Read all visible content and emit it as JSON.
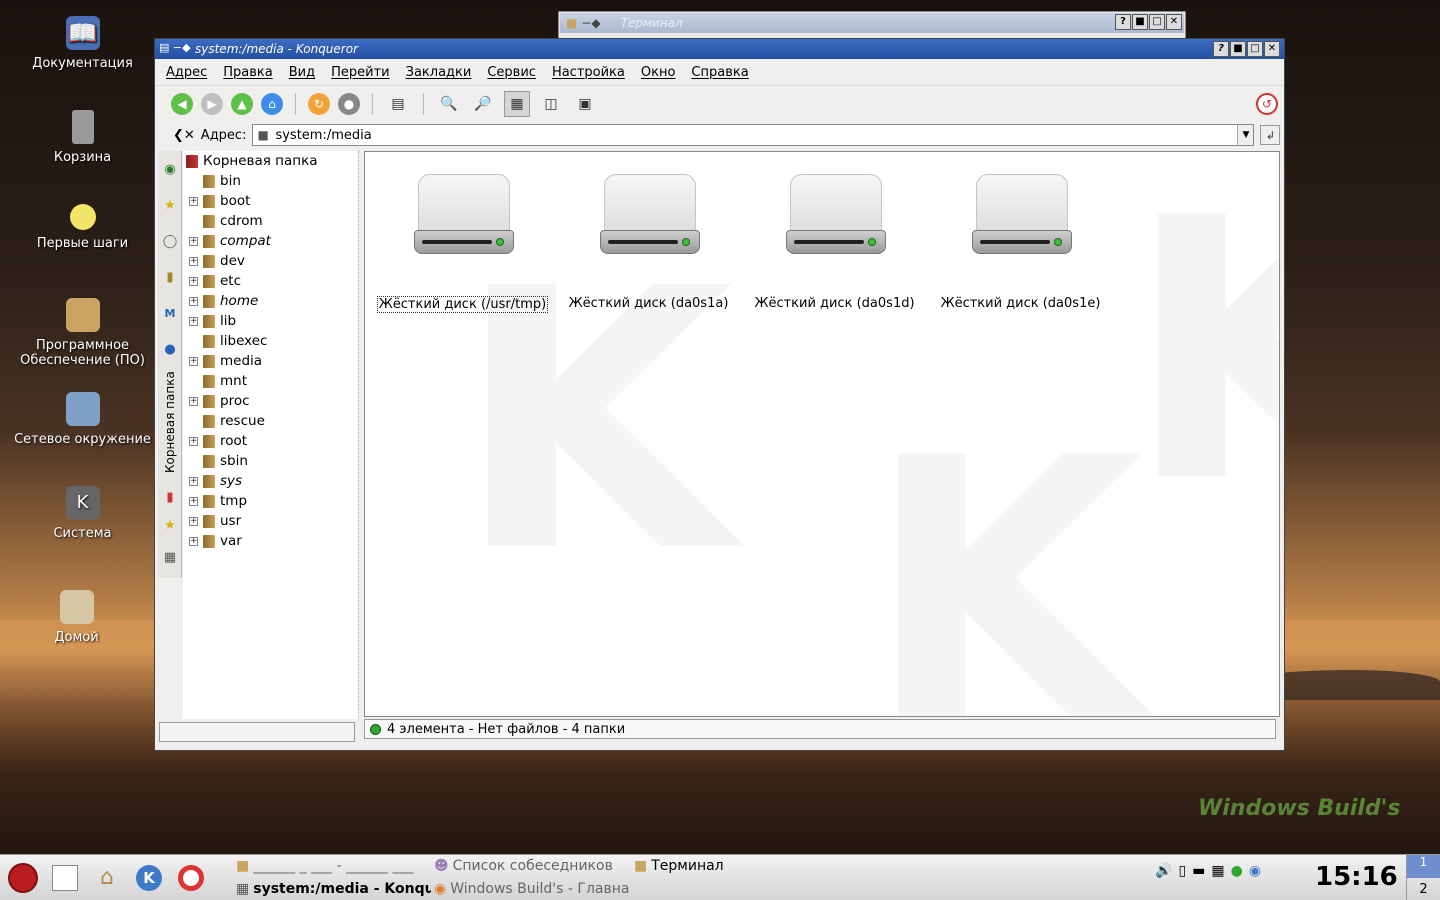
{
  "desktop": {
    "icons": [
      {
        "label": "Документация",
        "icon": "book-icon"
      },
      {
        "label": "Корзина",
        "icon": "trash-icon"
      },
      {
        "label": "Первые шаги",
        "icon": "lightbulb-icon"
      },
      {
        "label": "Программное Обеспечение (ПО)",
        "icon": "package-icon"
      },
      {
        "label": "Сетевое окружение",
        "icon": "network-icon"
      },
      {
        "label": "Система",
        "icon": "system-icon"
      },
      {
        "label": "Домой",
        "icon": "home-icon"
      }
    ],
    "logo_text": "Windows Build's"
  },
  "terminal_window": {
    "title": "Терминал"
  },
  "window": {
    "title": "system:/media - Konqueror",
    "menu": [
      "Адрес",
      "Правка",
      "Вид",
      "Перейти",
      "Закладки",
      "Сервис",
      "Настройка",
      "Окно",
      "Справка"
    ],
    "address_label": "Адрес:",
    "address_value": "system:/media",
    "sidebar_tab_label": "Корневая папка",
    "tree": {
      "root": "Корневая папка",
      "items": [
        {
          "name": "bin",
          "expandable": false,
          "italic": false
        },
        {
          "name": "boot",
          "expandable": true,
          "italic": false
        },
        {
          "name": "cdrom",
          "expandable": false,
          "italic": false
        },
        {
          "name": "compat",
          "expandable": true,
          "italic": true
        },
        {
          "name": "dev",
          "expandable": true,
          "italic": false
        },
        {
          "name": "etc",
          "expandable": true,
          "italic": false
        },
        {
          "name": "home",
          "expandable": true,
          "italic": true
        },
        {
          "name": "lib",
          "expandable": true,
          "italic": false
        },
        {
          "name": "libexec",
          "expandable": false,
          "italic": false
        },
        {
          "name": "media",
          "expandable": true,
          "italic": false
        },
        {
          "name": "mnt",
          "expandable": false,
          "italic": false
        },
        {
          "name": "proc",
          "expandable": true,
          "italic": false
        },
        {
          "name": "rescue",
          "expandable": false,
          "italic": false
        },
        {
          "name": "root",
          "expandable": true,
          "italic": false
        },
        {
          "name": "sbin",
          "expandable": false,
          "italic": false
        },
        {
          "name": "sys",
          "expandable": true,
          "italic": true
        },
        {
          "name": "tmp",
          "expandable": true,
          "italic": false
        },
        {
          "name": "usr",
          "expandable": true,
          "italic": false
        },
        {
          "name": "var",
          "expandable": true,
          "italic": false
        }
      ]
    },
    "drives": [
      {
        "label": "Жёсткий диск (/usr/tmp)",
        "selected": true
      },
      {
        "label": "Жёсткий диск (da0s1a)",
        "selected": false
      },
      {
        "label": "Жёсткий диск (da0s1d)",
        "selected": false
      },
      {
        "label": "Жёсткий диск (da0s1e)",
        "selected": false
      }
    ],
    "status": "4 элемента - Нет файлов - 4 папки"
  },
  "taskbar": {
    "tasks": [
      {
        "label": "______ _ ___ - ______ ___",
        "icon": "terminal-icon"
      },
      {
        "label": "Список собеседников",
        "icon": "chat-icon"
      },
      {
        "label": "Терминал",
        "icon": "terminal-icon"
      },
      {
        "label": "system:/media - Konqueror",
        "icon": "konqueror-icon"
      },
      {
        "label": "Windows Build's - Главная",
        "icon": "firefox-icon"
      }
    ],
    "clock": "15:16",
    "pager_current": "1",
    "pager_other": "2"
  },
  "colors": {
    "titlebar": "#2a58ad",
    "accent_green": "#2fa62f"
  }
}
